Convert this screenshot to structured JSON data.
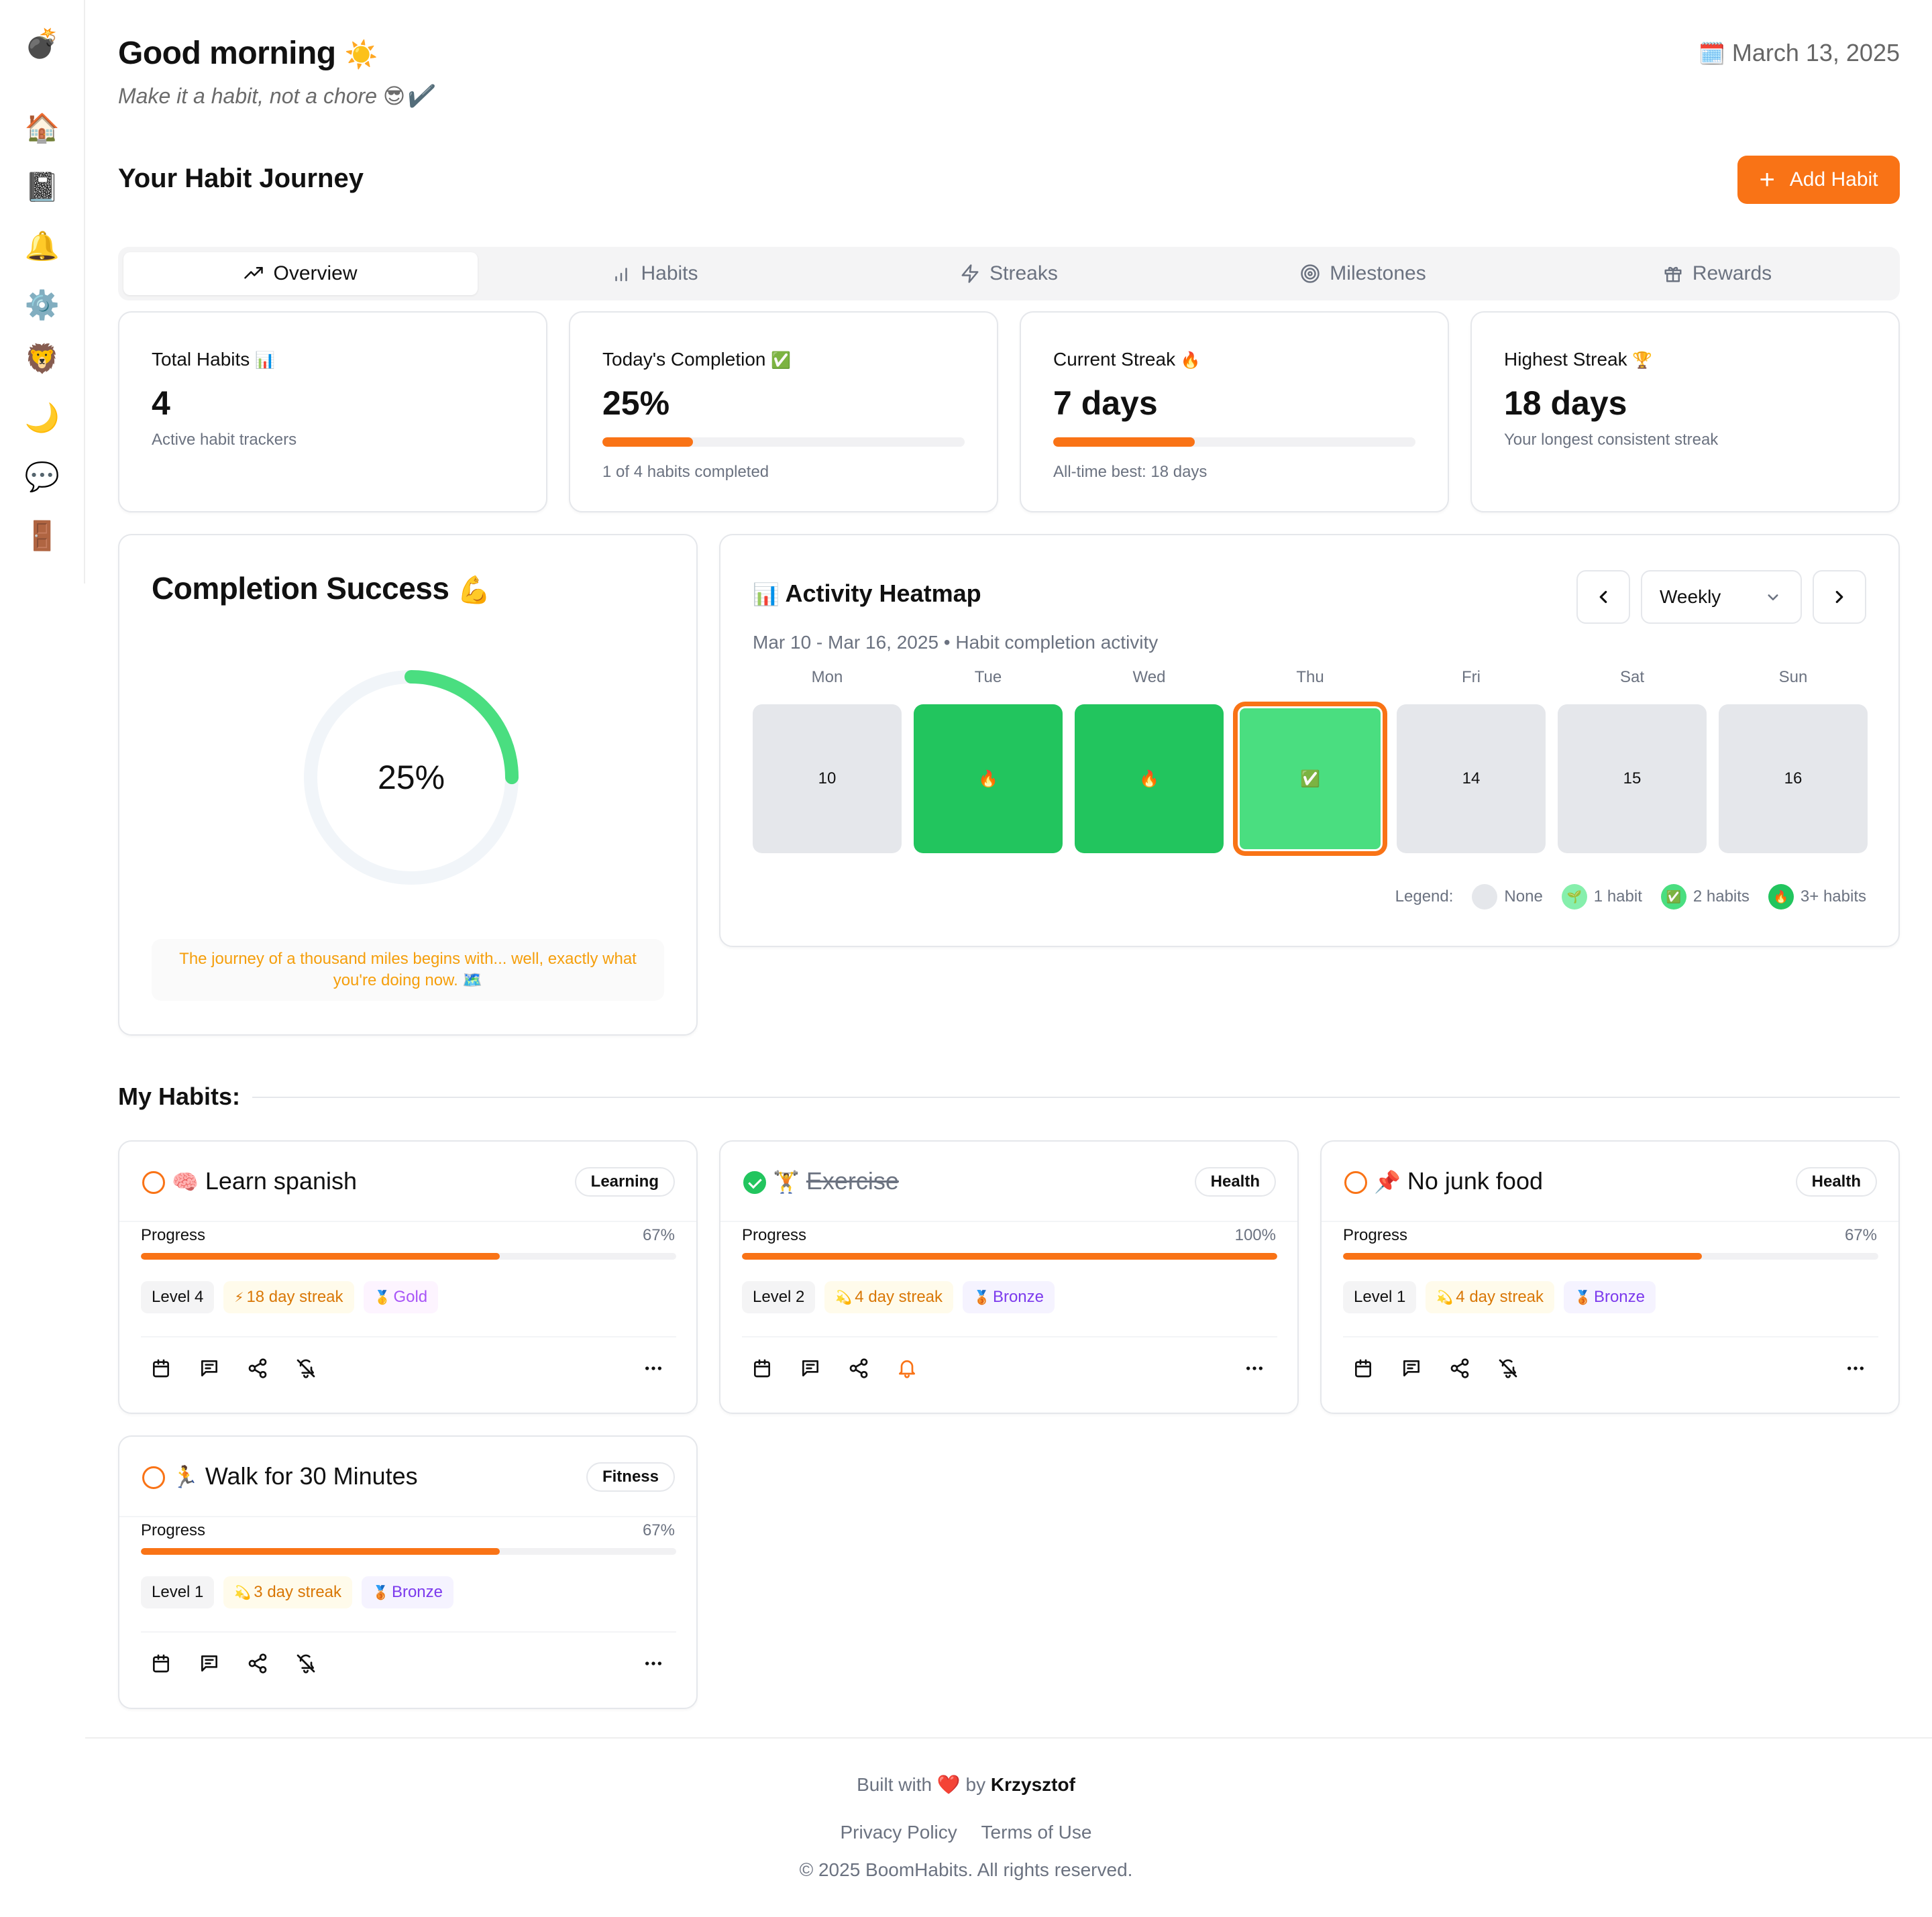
{
  "sidebar": {
    "logo": "💣",
    "items": [
      {
        "icon": "🏠",
        "name": "home-icon"
      },
      {
        "icon": "📓",
        "name": "notebook-icon"
      },
      {
        "icon": "🔔",
        "name": "bell-icon"
      },
      {
        "icon": "⚙️",
        "name": "gear-icon"
      },
      {
        "icon": "🦁",
        "name": "lion-icon"
      },
      {
        "icon": "🌙",
        "name": "moon-icon"
      },
      {
        "icon": "💬",
        "name": "chat-icon"
      },
      {
        "icon": "🚪",
        "name": "door-icon"
      }
    ]
  },
  "header": {
    "greeting": "Good morning",
    "greeting_emoji": "☀️",
    "tagline": "Make it a habit, not a chore 😎✔️",
    "date_emoji": "🗓️",
    "date": "March 13, 2025",
    "section_title": "Your Habit Journey",
    "add_button": "Add Habit"
  },
  "tabs": [
    {
      "label": "Overview",
      "icon": "trending-up-icon"
    },
    {
      "label": "Habits",
      "icon": "bar-chart-icon"
    },
    {
      "label": "Streaks",
      "icon": "lightning-icon"
    },
    {
      "label": "Milestones",
      "icon": "target-icon"
    },
    {
      "label": "Rewards",
      "icon": "gift-icon"
    }
  ],
  "stats": [
    {
      "label": "Total Habits",
      "emoji": "📊",
      "value": "4",
      "sub": "Active habit trackers"
    },
    {
      "label": "Today's Completion",
      "emoji": "✅",
      "value": "25%",
      "progress": 25,
      "sub": "1 of 4 habits completed"
    },
    {
      "label": "Current Streak",
      "emoji": "🔥",
      "value": "7 days",
      "progress": 39,
      "sub": "All-time best: 18 days"
    },
    {
      "label": "Highest Streak",
      "emoji": "🏆",
      "value": "18 days",
      "sub": "Your longest consistent streak"
    }
  ],
  "completion": {
    "title": "Completion Success",
    "emoji": "💪",
    "percent": 25,
    "percent_label": "25%",
    "quote": "The journey of a thousand miles begins with... well, exactly what you're doing now. 🗺️"
  },
  "heatmap": {
    "emoji": "📊",
    "title": "Activity Heatmap",
    "range": "Mar 10 - Mar 16, 2025 • Habit completion activity",
    "period": "Weekly",
    "days": [
      {
        "name": "Mon",
        "label": "10",
        "level": 0
      },
      {
        "name": "Tue",
        "label": "🔥",
        "level": 3
      },
      {
        "name": "Wed",
        "label": "🔥",
        "level": 3
      },
      {
        "name": "Thu",
        "label": "✅",
        "level": 2,
        "today": true
      },
      {
        "name": "Fri",
        "label": "14",
        "level": 0
      },
      {
        "name": "Sat",
        "label": "15",
        "level": 0
      },
      {
        "name": "Sun",
        "label": "16",
        "level": 0
      }
    ],
    "legend_title": "Legend:",
    "legend": [
      {
        "label": "None",
        "emoji": "",
        "color": "#e5e7eb"
      },
      {
        "label": "1 habit",
        "emoji": "🌱",
        "color": "#86efac"
      },
      {
        "label": "2 habits",
        "emoji": "✅",
        "color": "#4ade80"
      },
      {
        "label": "3+ habits",
        "emoji": "🔥",
        "color": "#22c55e"
      }
    ]
  },
  "my_habits": {
    "title": "My Habits:",
    "progress_label": "Progress",
    "items": [
      {
        "emoji": "🧠",
        "name": "Learn spanish",
        "category": "Learning",
        "done": false,
        "progress": 67,
        "progress_label": "67%",
        "level": "Level 4",
        "streak_emoji": "⚡",
        "streak": "18 day streak",
        "medal_emoji": "🥇",
        "medal": "Gold",
        "bell_active": false
      },
      {
        "emoji": "🏋️",
        "name": "Exercise",
        "category": "Health",
        "done": true,
        "progress": 100,
        "progress_label": "100%",
        "level": "Level 2",
        "streak_emoji": "💫",
        "streak": "4 day streak",
        "medal_emoji": "🥉",
        "medal": "Bronze",
        "bell_active": true
      },
      {
        "emoji": "📌",
        "name": "No junk food",
        "category": "Health",
        "done": false,
        "progress": 67,
        "progress_label": "67%",
        "level": "Level 1",
        "streak_emoji": "💫",
        "streak": "4 day streak",
        "medal_emoji": "🥉",
        "medal": "Bronze",
        "bell_active": false
      },
      {
        "emoji": "🏃",
        "name": "Walk for 30 Minutes",
        "category": "Fitness",
        "done": false,
        "progress": 67,
        "progress_label": "67%",
        "level": "Level 1",
        "streak_emoji": "💫",
        "streak": "3 day streak",
        "medal_emoji": "🥉",
        "medal": "Bronze",
        "bell_active": false
      }
    ]
  },
  "footer": {
    "built_with": "Built with",
    "heart": "❤️",
    "by": "by",
    "author": "Krzysztof",
    "privacy": "Privacy Policy",
    "terms": "Terms of Use",
    "copyright": "© 2025 BoomHabits. All rights reserved."
  },
  "colors": {
    "accent": "#f97316",
    "green": "#22c55e",
    "green_light": "#4ade80",
    "none": "#e5e7eb",
    "donut_track": "#f1f5f9"
  }
}
